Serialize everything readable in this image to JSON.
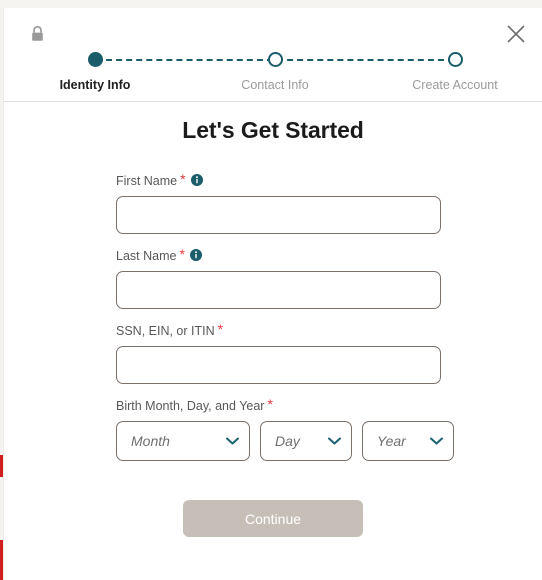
{
  "window": {
    "lock_icon": "lock-icon",
    "close_icon": "close-icon"
  },
  "stepper": {
    "steps": [
      {
        "label": "Identity Info",
        "state": "current"
      },
      {
        "label": "Contact Info",
        "state": "upcoming"
      },
      {
        "label": "Create Account",
        "state": "upcoming"
      }
    ],
    "accent_color": "#1b5c6b"
  },
  "main": {
    "title": "Let's Get Started",
    "required_marker": "*",
    "info_icon": "info-icon",
    "fields": [
      {
        "label": "First Name",
        "required": true,
        "has_info": true,
        "value": "",
        "placeholder": ""
      },
      {
        "label": "Last Name",
        "required": true,
        "has_info": true,
        "value": "",
        "placeholder": ""
      },
      {
        "label": "SSN, EIN, or ITIN",
        "required": true,
        "has_info": false,
        "value": "",
        "placeholder": ""
      }
    ],
    "birthdate": {
      "label": "Birth Month, Day, and Year",
      "required": true,
      "selects": [
        {
          "name": "month",
          "value": "Month"
        },
        {
          "name": "day",
          "value": "Day"
        },
        {
          "name": "year",
          "value": "Year"
        }
      ],
      "chevron_icon": "chevron-down-icon"
    },
    "submit": {
      "label": "Continue",
      "enabled": false,
      "disabled_color": "#c6bfb8"
    }
  },
  "colors": {
    "accent": "#1b5c6b",
    "required": "#e8373b",
    "field_border": "#7b716b",
    "page_background": "#f6f4f0",
    "edge_mark": "#cf1f1f"
  }
}
